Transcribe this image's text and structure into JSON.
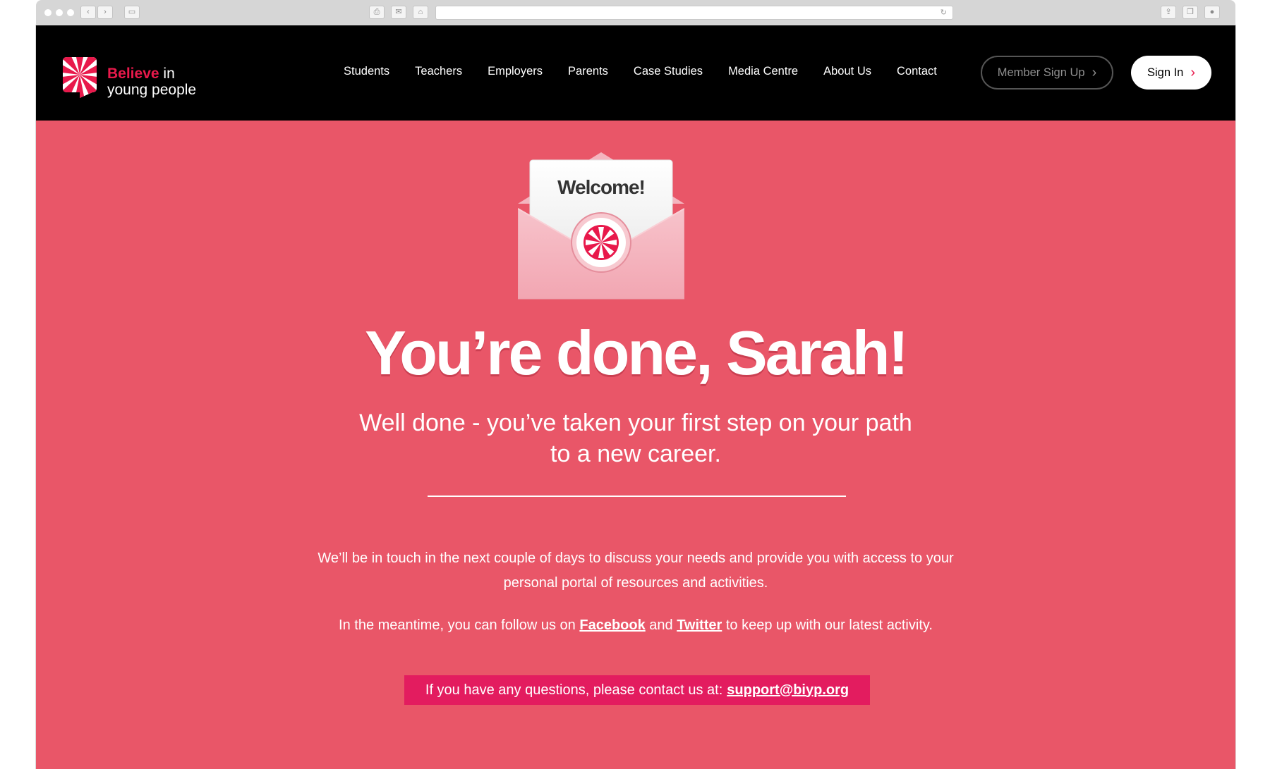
{
  "nav": {
    "logo_brand": "Believe",
    "logo_in": " in",
    "logo_line2": "young people",
    "links": [
      "Students",
      "Teachers",
      "Employers",
      "Parents",
      "Case Studies",
      "Media Centre",
      "About Us",
      "Contact"
    ],
    "member_signup": "Member Sign Up",
    "sign_in": "Sign In"
  },
  "hero": {
    "envelope_label": "Welcome!",
    "headline": "You’re done, Sarah!",
    "subhead": "Well done - you’ve taken your first step on your path to a new career."
  },
  "body": {
    "para1": "We’ll be in touch in the next couple of days to discuss your needs and provide you with access to your personal portal of resources and activities.",
    "para2_before": "In the meantime, you can follow us on ",
    "facebook": "Facebook",
    "para2_and": " and ",
    "twitter": "Twitter",
    "para2_after": " to keep up with our latest activity.",
    "contact_text": "If you have any questions, please contact us at:",
    "contact_email": "support@biyp.org"
  },
  "colors": {
    "hero_bg": "#e95668",
    "accent": "#e8194b",
    "contact_bg": "#e31c5f",
    "nav_bg": "#000000"
  },
  "icons": [
    "back-arrow-icon",
    "forward-arrow-icon",
    "sidebar-icon",
    "print-icon",
    "mail-icon",
    "home-icon",
    "reload-icon",
    "share-icon",
    "tabs-icon",
    "download-icon",
    "envelope-icon",
    "chevron-right-icon"
  ]
}
